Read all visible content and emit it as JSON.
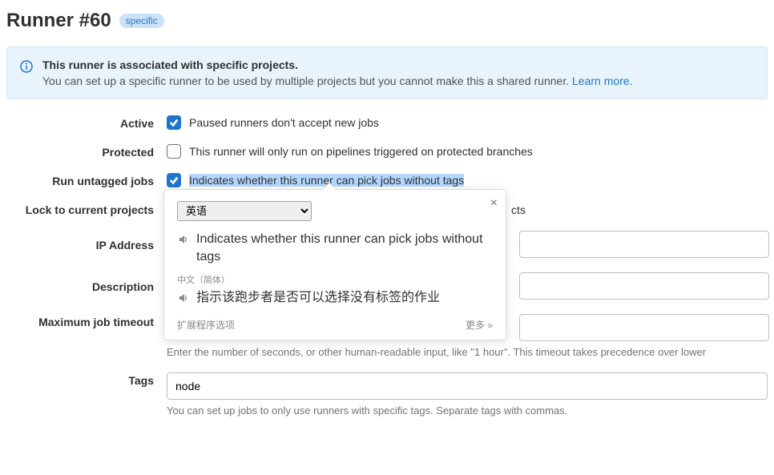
{
  "header": {
    "title": "Runner #60",
    "badge": "specific"
  },
  "banner": {
    "title": "This runner is associated with specific projects.",
    "text": "You can set up a specific runner to be used by multiple projects but you cannot make this a shared runner. ",
    "link": "Learn more."
  },
  "form": {
    "active": {
      "label": "Active",
      "description": "Paused runners don't accept new jobs"
    },
    "protected": {
      "label": "Protected",
      "description": "This runner will only run on pipelines triggered on protected branches"
    },
    "untagged": {
      "label": "Run untagged jobs",
      "description": "Indicates whether this runner can pick jobs without tags"
    },
    "lock": {
      "label": "Lock to current projects",
      "partial_text": "cts"
    },
    "ip": {
      "label": "IP Address"
    },
    "description": {
      "label": "Description"
    },
    "timeout": {
      "label": "Maximum job timeout",
      "help": "Enter the number of seconds, or other human-readable input, like \"1 hour\". This timeout takes precedence over lower"
    },
    "tags": {
      "label": "Tags",
      "value": "node",
      "help": "You can set up jobs to only use runners with specific tags. Separate tags with commas."
    }
  },
  "tooltip": {
    "language": "英语",
    "source_text": "Indicates whether this runner can pick jobs without tags",
    "target_lang": "中文（简体）",
    "target_text": "指示该跑步者是否可以选择没有标签的作业",
    "footer_left": "扩展程序选项",
    "footer_right": "更多 »"
  }
}
